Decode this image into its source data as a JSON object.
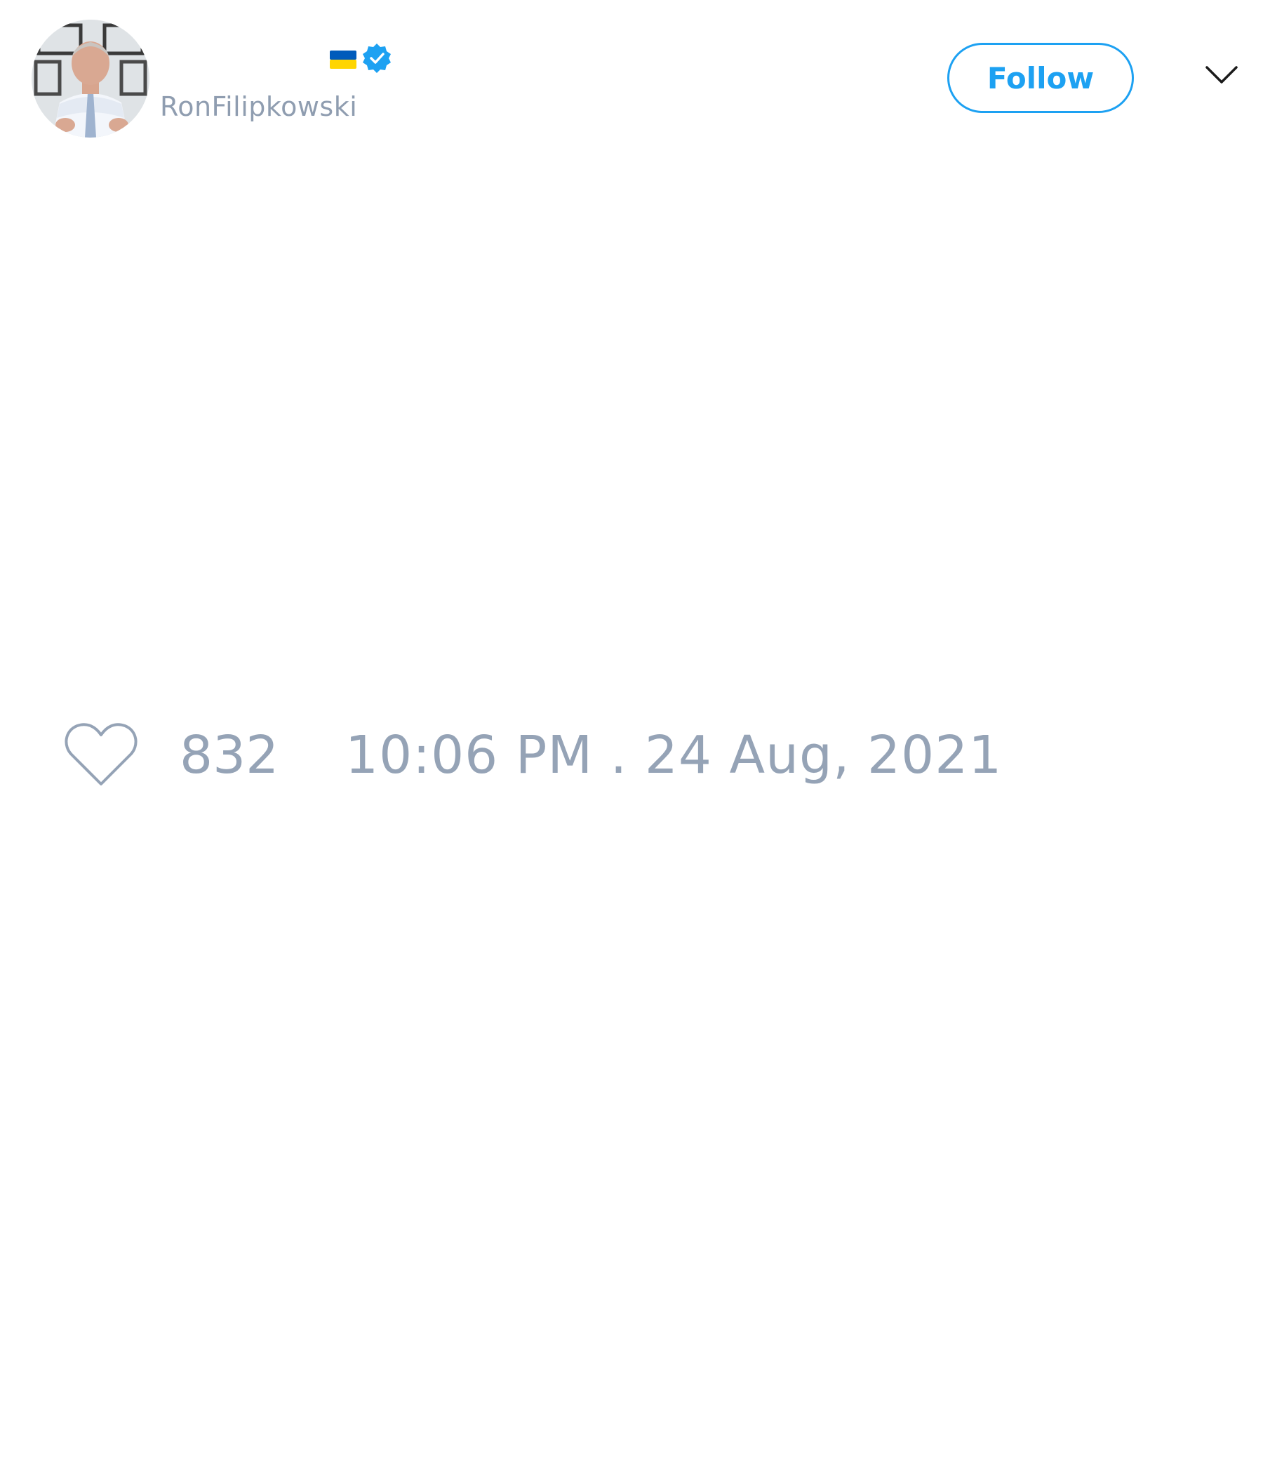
{
  "user": {
    "display_name": "",
    "handle": "RonFilipkowski",
    "flag_icon": "ukraine-flag-icon",
    "verified_icon": "verified-badge-icon",
    "avatar": "profile-photo"
  },
  "actions": {
    "follow_label": "Follow",
    "menu_icon": "chevron-down-icon"
  },
  "stats": {
    "like_icon": "heart-icon",
    "likes": "832",
    "timestamp": "10:06 PM . 24 Aug, 2021"
  },
  "colors": {
    "accent": "#1da1f2",
    "muted_text": "#95a3b6",
    "flag_blue": "#005bbb",
    "flag_yellow": "#ffd500"
  }
}
